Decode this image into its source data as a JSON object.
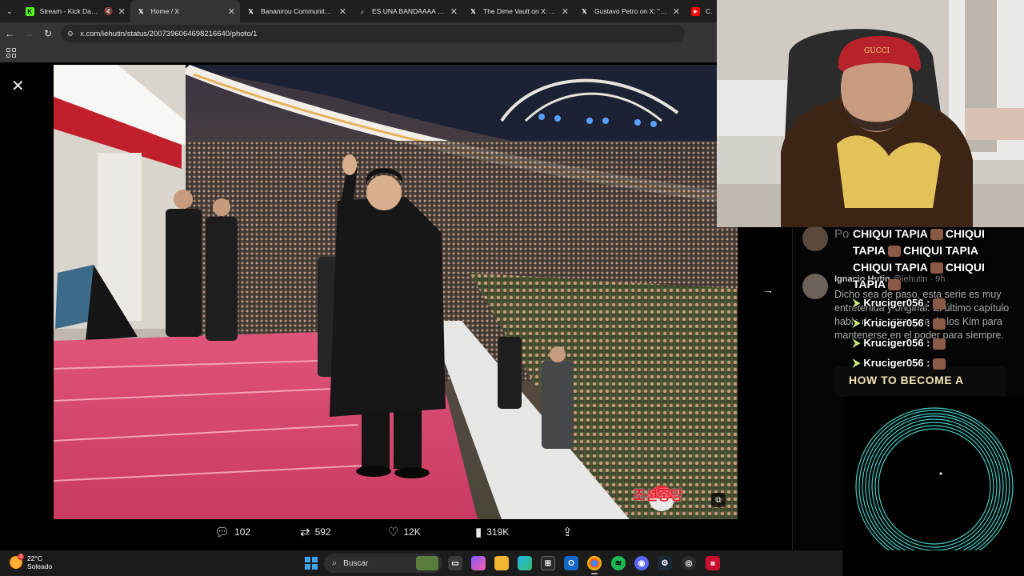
{
  "browser": {
    "tabs": [
      {
        "title": "Stream - Kick Dashbo",
        "favicon": "K",
        "color": "#53fc18",
        "muted": true
      },
      {
        "title": "Home / X",
        "favicon": "X",
        "color": "#000000",
        "active": true
      },
      {
        "title": "Bananirou Community / X",
        "favicon": "X",
        "color": "#000000"
      },
      {
        "title": "ES UNA BANDAAAA #par",
        "favicon": "T",
        "color": "#111111"
      },
      {
        "title": "The Dime Vault on X: \"He",
        "favicon": "X",
        "color": "#000000"
      },
      {
        "title": "Gustavo Petro on X: \"Bala",
        "favicon": "X",
        "color": "#000000"
      },
      {
        "title": "Cayc",
        "favicon": "▶",
        "color": "#ff0000"
      }
    ],
    "url": "x.com/iehutin/status/2007396064698216640/photo/1"
  },
  "actions": {
    "replies": "102",
    "reposts": "592",
    "likes": "12K",
    "views": "319K"
  },
  "photo": {
    "watermark": "조선중앙"
  },
  "sidebar": {
    "reply_author": "Ignacio Hutin",
    "reply_handle": "@iehutin · 9h",
    "reply_text": "Dicho sea de paso, esta serie es muy entretenida y original. El último capítulo habla de la estrategia de los Kim para mantenerse en el poder para siempre.",
    "top_text": "Po"
  },
  "chat": {
    "lines": [
      [
        "CHIQUI TAPIA",
        "CHIQUI"
      ],
      [
        "TAPIA",
        "CHIQUI TAPIA"
      ],
      [
        "CHIQUI TAPIA",
        "CHIQUI"
      ],
      [
        "TAPIA"
      ]
    ],
    "kruciger": [
      "Kruciger056 :",
      "Kruciger056 :",
      "Kruciger056 :",
      "Kruciger056 :"
    ],
    "thumbnail_title": "HOW TO BECOME A"
  },
  "taskbar": {
    "temperature": "22°C",
    "condition": "Soleado",
    "search_label": "Buscar"
  }
}
